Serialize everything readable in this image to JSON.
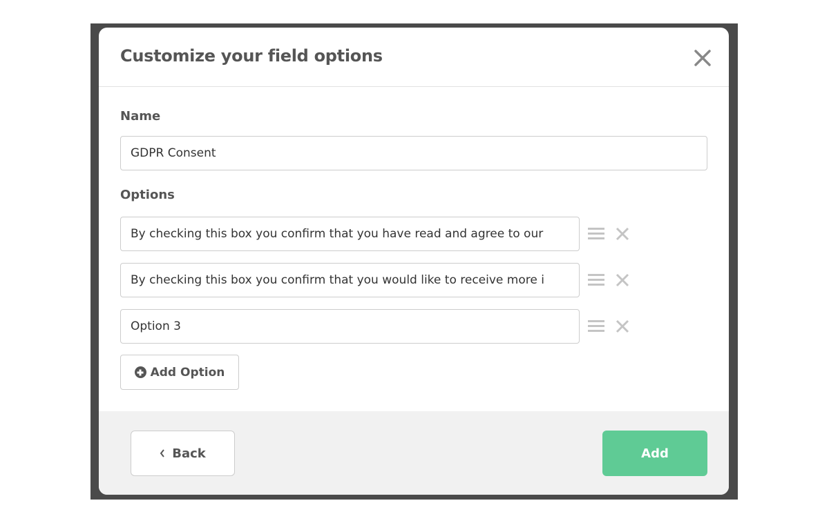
{
  "modal": {
    "title": "Customize your field options",
    "close_icon": "close-icon"
  },
  "name": {
    "label": "Name",
    "value": "GDPR Consent"
  },
  "options": {
    "label": "Options",
    "items": [
      {
        "value": "By checking this box you confirm that you have read and agree to our"
      },
      {
        "value": "By checking this box you confirm that you would like to receive more i"
      },
      {
        "value": "Option 3"
      }
    ],
    "add_label": "Add Option"
  },
  "footer": {
    "back_label": "Back",
    "add_label": "Add"
  },
  "colors": {
    "accent": "#5fcb95",
    "text": "#555555",
    "footer_bg": "#f1f1f1"
  }
}
